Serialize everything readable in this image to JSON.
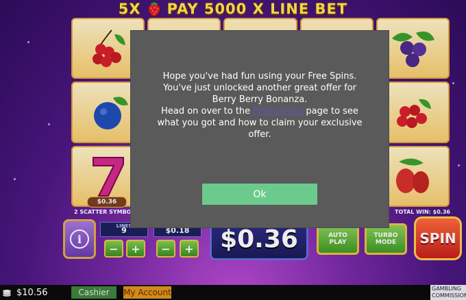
{
  "game": {
    "banner_text_left": "5X",
    "banner_text_right": "PAY 5000 X LINE BET",
    "win_tag": "$0.36",
    "scatter_label": "2 SCATTER SYMBO",
    "total_win_label": "TOTAL WIN: $0.36",
    "lines_caption": "LINES",
    "lines_value": "9",
    "line_bet_value": "$0.18",
    "bet_total": "$0.36",
    "autoplay_line1": "AUTO",
    "autoplay_line2": "PLAY",
    "turbo_line1": "TURBO",
    "turbo_line2": "MODE",
    "spin_label": "SPIN",
    "minus": "−",
    "plus": "+",
    "info": "i"
  },
  "modal": {
    "line1": "Hope you've had fun using your Free Spins.",
    "line2": "You've just unlocked another great offer for",
    "line3": "Berry Berry Bonanza.",
    "line4_pre": "Head on over to the ",
    "line4_link": "Promotions",
    "line4_post": " page to see",
    "line5": "what you got and how to claim your exclusive",
    "line6": "offer.",
    "ok_label": "Ok"
  },
  "bottom_bar": {
    "balance": "$10.56",
    "cashier": "Cashier",
    "my_account": "My Account",
    "logo_text": "GAMBLING COMMISSION"
  },
  "colors": {
    "modal_bg": "#5a5a5a",
    "ok_button": "#6ccb8c",
    "cashier": "#3a7a3a",
    "account": "#d28a1a"
  },
  "icons": {
    "info": "info-icon",
    "coins": "coins-icon",
    "strawberry": "strawberry-icon"
  }
}
